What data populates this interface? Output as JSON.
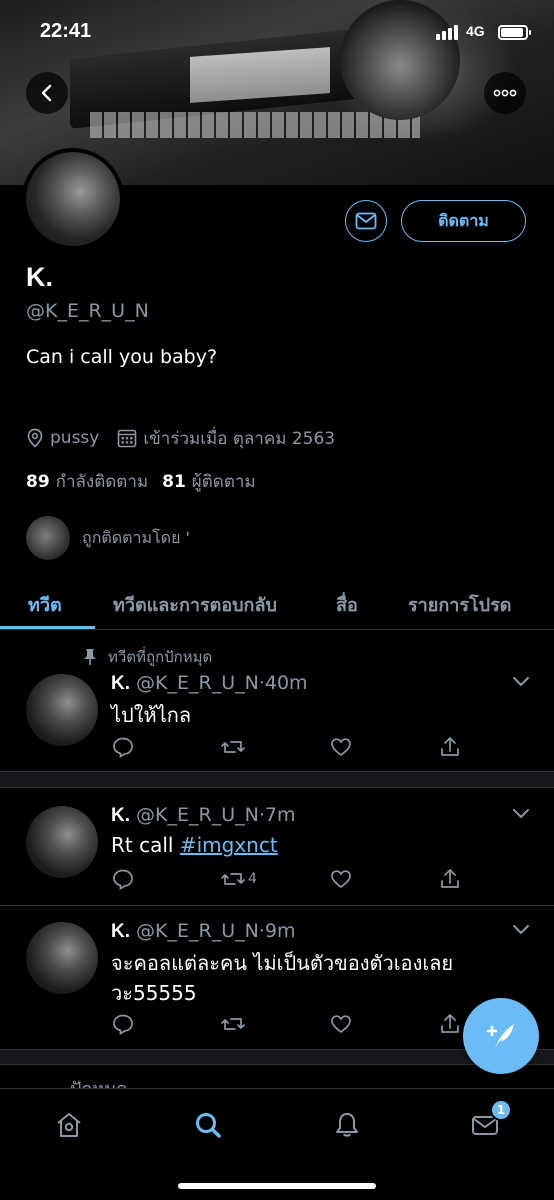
{
  "status_bar": {
    "time": "22:41",
    "network": "4G",
    "battery_level": 0.9
  },
  "profile": {
    "name": "K.",
    "handle": "@K_E_R_U_N",
    "bio": "Can i call you baby?",
    "location": "pussy",
    "joined": "เข้าร่วมเมื่อ ตุลาคม 2563",
    "following_count": "89",
    "following_label": "กำลังติดตาม",
    "followers_count": "81",
    "followers_label": "ผู้ติดตาม",
    "followed_by_text": "ถูกติดตามโดย '",
    "follow_button": "ติดตาม"
  },
  "tabs": [
    {
      "label": "ทวีต",
      "active": true
    },
    {
      "label": "ทวีตและการตอบกลับ",
      "active": false
    },
    {
      "label": "สื่อ",
      "active": false
    },
    {
      "label": "รายการโปรด",
      "active": false
    }
  ],
  "pinned_label": "ทวีตที่ถูกปักหมุด",
  "tweets": [
    {
      "name": "K.",
      "handle": "@K_E_R_U_N",
      "time": "·40m",
      "text": "ไปให้ไกล",
      "retweets": ""
    },
    {
      "name": "K.",
      "handle": "@K_E_R_U_N",
      "time": "·7m",
      "text_prefix": "Rt call ",
      "hashtag": "#imgxnct",
      "retweets": "4"
    },
    {
      "name": "K.",
      "handle": "@K_E_R_U_N",
      "time": "·9m",
      "text_line1": "จะคอลแต่ละคน ไม่เป็นตัวของตัวเองเลย",
      "text_line2": "วะ55555",
      "retweets": ""
    }
  ],
  "partial_next_tweet": "ปักหมุด",
  "nav": {
    "messages_badge": "1",
    "active": "search"
  },
  "colors": {
    "accent": "#6bbcf5",
    "secondary_text": "#8899a6",
    "background": "#000000"
  }
}
